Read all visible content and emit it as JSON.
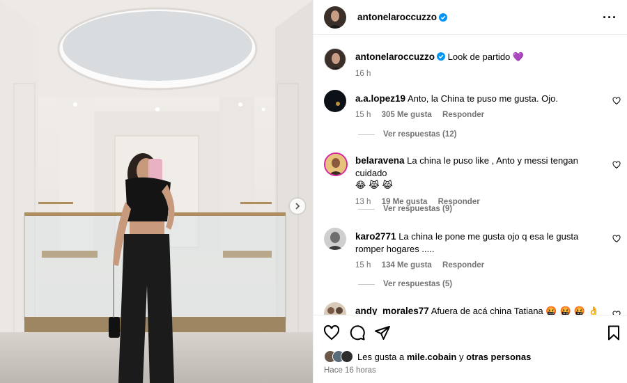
{
  "post": {
    "author": "antonelaroccuzzo",
    "caption_username": "antonelaroccuzzo",
    "caption_text": "Look de partido",
    "caption_emoji": "💜",
    "caption_time": "16 h"
  },
  "comments": [
    {
      "username": "a.a.lopez19",
      "text": "Anto, la China te puso me gusta. Ojo.",
      "time": "15 h",
      "likes": "305 Me gusta",
      "reply": "Responder",
      "view_replies": "Ver respuestas (12)"
    },
    {
      "username": "belaravena",
      "text": "La china le puso like , Anto y messi tengan cuidado",
      "emoji": "😂 😹 😹",
      "time": "13 h",
      "likes": "19 Me gusta",
      "reply": "Responder",
      "view_replies": "Ver respuestas (9)"
    },
    {
      "username": "karo2771",
      "text": "La china le pone me gusta ojo q esa le gusta romper hogares .....",
      "time": "15 h",
      "likes": "134 Me gusta",
      "reply": "Responder",
      "view_replies": "Ver respuestas (5)"
    },
    {
      "username": "andy_morales77",
      "text": "Afuera de acá china Tatiana",
      "emoji": "🤬 🤬 🤬 👌"
    }
  ],
  "likes": {
    "prefix": "Les gusta a",
    "user": "mile.cobain",
    "conj": "y",
    "others": "otras personas"
  },
  "posted_ago": "Hace 16 horas",
  "icons": {
    "more": "more-options-icon",
    "like": "heart-icon",
    "comment": "comment-icon",
    "share": "send-icon",
    "save": "bookmark-icon",
    "next": "chevron-right-icon",
    "verified": "verified-badge-icon"
  },
  "colors": {
    "verified": "#0095f6",
    "meta": "#737373"
  }
}
